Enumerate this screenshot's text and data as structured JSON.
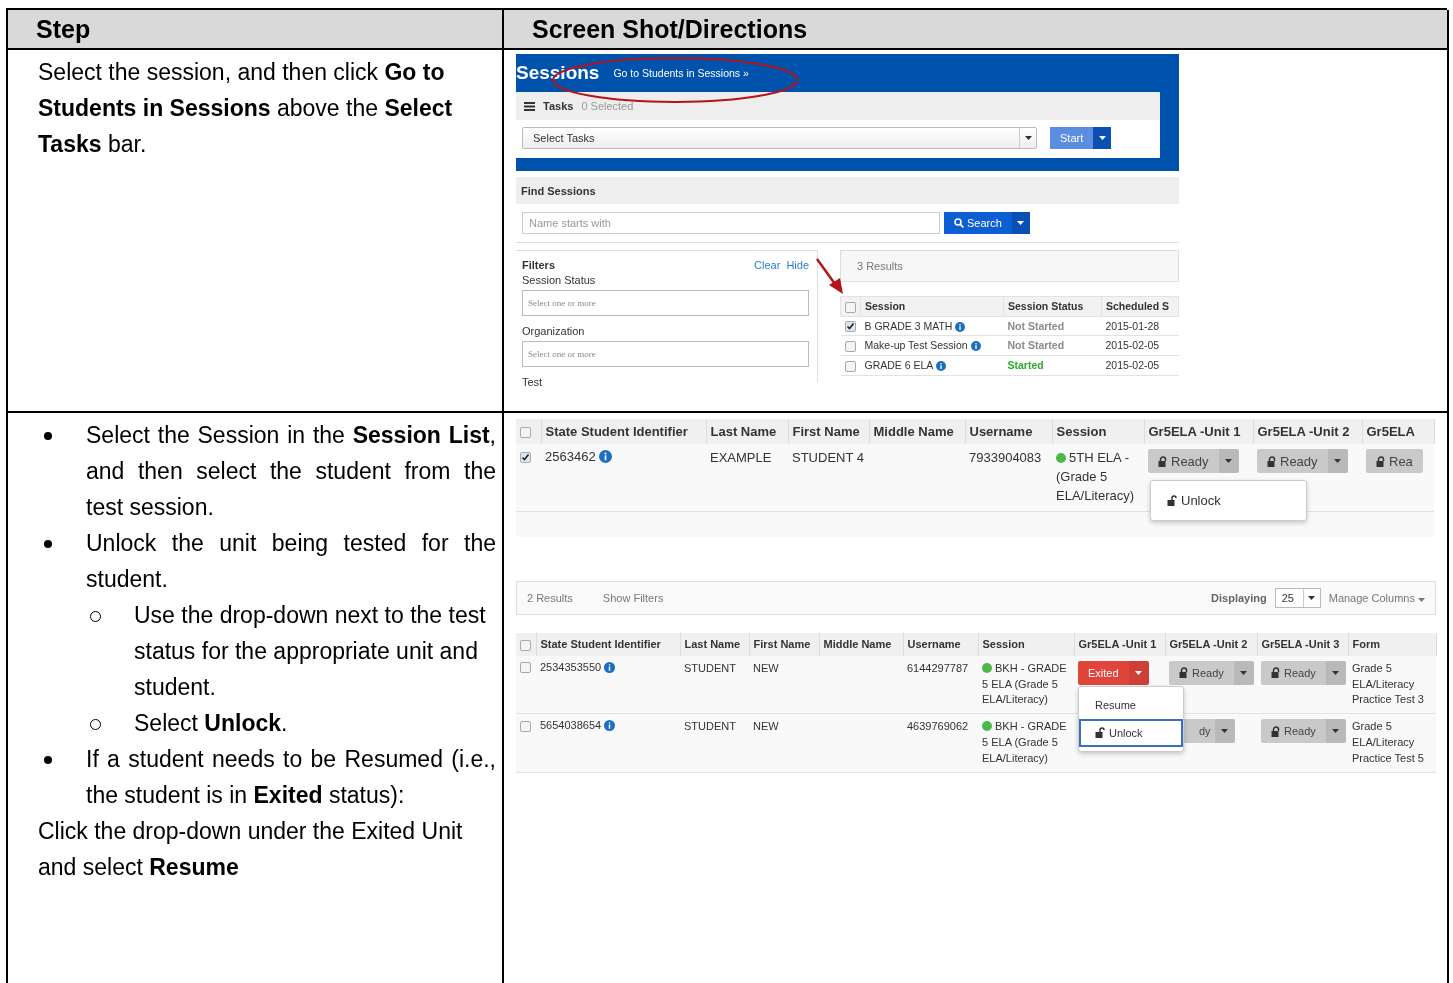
{
  "table": {
    "columns": [
      "Step",
      "Screen Shot/Directions"
    ],
    "rows": [
      {
        "step": {
          "paragraphs": [
            "Select the session, and then click **Go to Students in Sessions** above the **Select Tasks** bar."
          ]
        },
        "sessions_screen": {
          "title": "Sessions",
          "link": "Go to Students in Sessions »",
          "tasks_label": "Tasks",
          "tasks_count": "0 Selected",
          "task_select": "Select Tasks",
          "start_button": "Start",
          "find_title": "Find Sessions",
          "search": {
            "placeholder": "Name starts with"
          },
          "search_button": "Search",
          "filters": {
            "title": "Filters",
            "clear": "Clear",
            "hide": "Hide",
            "fields": [
              {
                "label": "Session Status",
                "placeholder": "Select one or more"
              },
              {
                "label": "Organization",
                "placeholder": "Select one or more"
              }
            ],
            "last_label": "Test"
          },
          "results": {
            "count": "3 Results",
            "select_all_checked": false,
            "columns": [
              "Session",
              "Session Status",
              "Scheduled S"
            ],
            "rows": [
              {
                "checked": true,
                "session": "B GRADE 3 MATH",
                "status": "Not Started",
                "color": "#8a8a8a",
                "date": "2015-01-28"
              },
              {
                "checked": false,
                "session": "Make-up Test Session",
                "status": "Not Started",
                "color": "#8a8a8a",
                "date": "2015-02-05"
              },
              {
                "checked": false,
                "session": "GRADE 6 ELA",
                "status": "Started",
                "color": "#2eaa2e",
                "date": "2015-02-05"
              }
            ]
          }
        }
      },
      {
        "step": {
          "bullets": [
            {
              "text": "Select the Session in the **Session List**, and then select the student from the test session."
            },
            {
              "text": "Unlock the unit being tested for the student.",
              "children": [
                {
                  "text": "Use the drop-down next to the test status for the appropriate unit and student."
                },
                {
                  "text": "Select **Unlock**."
                }
              ]
            },
            {
              "text": "If a student needs to be Resumed (i.e., the student is in **Exited** status):"
            }
          ],
          "paragraphs": [
            "Click the drop-down under the Exited Unit and select **Resume**"
          ]
        },
        "student_table": {
          "select_all_checked": false,
          "columns": [
            "State Student Identifier",
            "Last Name",
            "First Name",
            "Middle Name",
            "Username",
            "Session",
            "Gr5ELA -Unit 1",
            "Gr5ELA -Unit 2",
            "Gr5ELA"
          ],
          "rows": [
            {
              "checked": true,
              "id": "2563462",
              "last": "EXAMPLE",
              "first": "STUDENT 4",
              "username": "7933904083",
              "session": "5TH ELA - (Grade 5 ELA/Literacy)",
              "units": [
                {
                  "kind": "ready",
                  "label": "Ready"
                },
                {
                  "kind": "ready",
                  "label": "Ready"
                },
                {
                  "kind": "cut",
                  "label": "Rea"
                }
              ]
            }
          ],
          "menu": {
            "items": [
              {
                "label": "Unlock",
                "highlighted": false
              }
            ]
          }
        },
        "results_table": {
          "count": "2 Results",
          "show_filters": "Show Filters",
          "displaying_label": "Displaying",
          "displaying_value": "25",
          "manage_columns": "Manage Columns",
          "select_all_checked": false,
          "columns": [
            "State Student Identifier",
            "Last Name",
            "First Name",
            "Middle Name",
            "Username",
            "Session",
            "Gr5ELA -Unit 1",
            "Gr5ELA -Unit 2",
            "Gr5ELA -Unit 3",
            "Form"
          ],
          "rows": [
            {
              "checked": false,
              "id": "2534353550",
              "last": "STUDENT",
              "first": "NEW",
              "username": "6144297787",
              "session": "BKH - GRADE 5 ELA (Grade 5 ELA/Literacy)",
              "form": "Grade 5 ELA/Literacy Practice Test 3",
              "units": [
                {
                  "kind": "exited",
                  "label": "Exited"
                },
                {
                  "kind": "ready",
                  "label": "Ready"
                },
                {
                  "kind": "ready",
                  "label": "Ready"
                }
              ]
            },
            {
              "checked": false,
              "id": "5654038654",
              "last": "STUDENT",
              "first": "NEW",
              "username": "4639769062",
              "session": "BKH - GRADE 5 ELA (Grade 5 ELA/Literacy)",
              "form": "Grade 5 ELA/Literacy Practice Test 5",
              "units": [
                {
                  "kind": "covered"
                },
                {
                  "kind": "partial",
                  "label": "dy"
                },
                {
                  "kind": "ready",
                  "label": "Ready"
                }
              ]
            }
          ],
          "menu": {
            "items": [
              {
                "label": "Resume",
                "highlighted": false
              },
              {
                "label": "Unlock",
                "highlighted": true
              }
            ]
          }
        }
      }
    ]
  }
}
